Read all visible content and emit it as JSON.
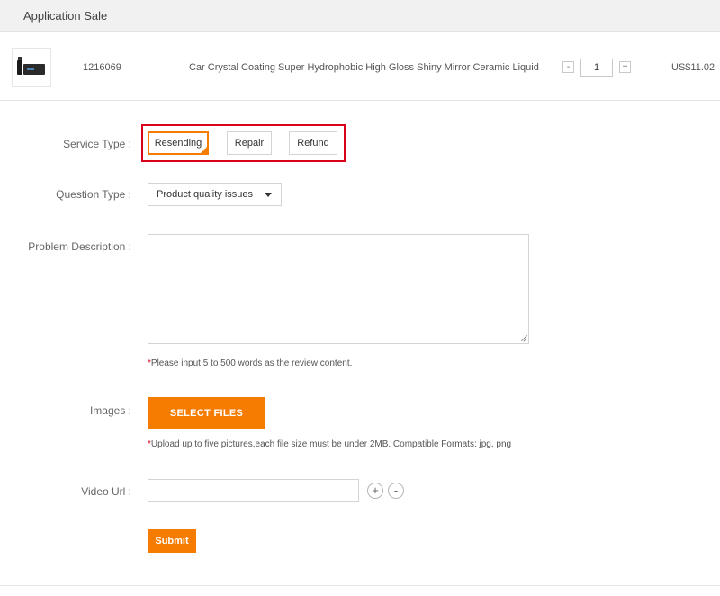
{
  "header": {
    "title": "Application Sale"
  },
  "product": {
    "order_id": "1216069",
    "name": "Car Crystal Coating Super Hydrophobic High Gloss Shiny Mirror Ceramic Liquid",
    "quantity": "1",
    "qty_minus": "-",
    "qty_plus": "+",
    "price": "US$11.02"
  },
  "form": {
    "service_type_label": "Service Type :",
    "service_options": [
      "Resending",
      "Repair",
      "Refund"
    ],
    "service_selected": "Resending",
    "question_type_label": "Question Type :",
    "question_type_value": "Product quality issues",
    "problem_label": "Problem Description :",
    "problem_value": "",
    "problem_hint_star": "*",
    "problem_hint": "Please input 5 to 500 words as the review content.",
    "images_label": "Images :",
    "select_files_label": "SELECT FILES",
    "images_hint_star": "*",
    "images_hint": "Upload up to five pictures,each file size must be under 2MB. Compatible Formats: jpg, png",
    "video_label": "Video Url :",
    "video_value": "",
    "add_symbol": "+",
    "remove_symbol": "-",
    "submit_label": "Submit"
  },
  "colors": {
    "accent": "#f57c00",
    "highlight_border": "#d9001b"
  },
  "icons": [
    "add-icon",
    "remove-icon",
    "dropdown-caret-icon",
    "selected-check-icon"
  ]
}
